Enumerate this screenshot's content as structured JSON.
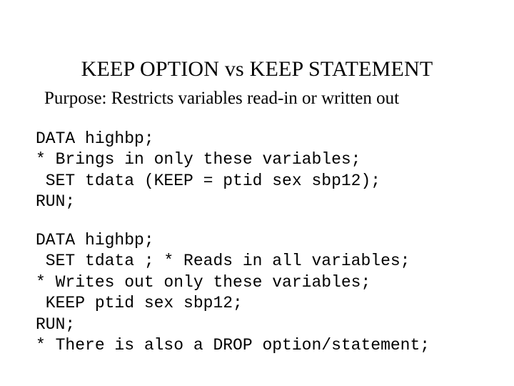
{
  "title": "KEEP OPTION vs KEEP STATEMENT",
  "purpose": "Purpose: Restricts variables read-in or written out",
  "code1": {
    "l1": "DATA highbp;",
    "l2": "* Brings in only these variables;",
    "l3": " SET tdata (KEEP = ptid sex sbp12);",
    "l4": "RUN;"
  },
  "code2": {
    "l1": "DATA highbp;",
    "l2": " SET tdata ; * Reads in all variables;",
    "l3": "* Writes out only these variables;",
    "l4": " KEEP ptid sex sbp12;",
    "l5": "RUN;",
    "l6": "* There is also a DROP option/statement;"
  }
}
